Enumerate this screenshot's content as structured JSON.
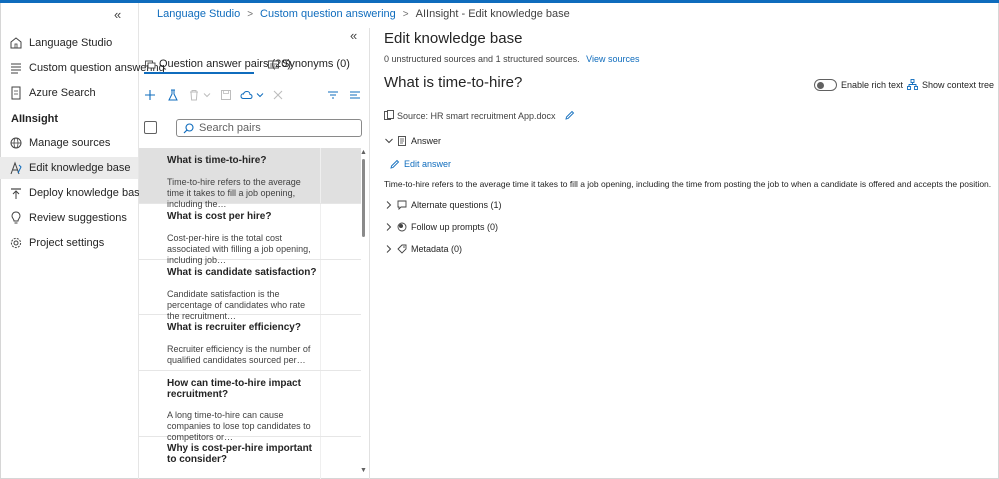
{
  "breadcrumb": {
    "items": [
      "Language Studio",
      "Custom question answering"
    ],
    "current": "AIInsight - Edit knowledge base"
  },
  "nav": {
    "top_items": [
      {
        "label": "Language Studio",
        "icon": "home-icon"
      },
      {
        "label": "Custom question answering",
        "icon": "list-icon"
      },
      {
        "label": "Azure Search",
        "icon": "document-icon"
      }
    ],
    "section": "AIInsight",
    "project_items": [
      {
        "label": "Manage sources",
        "icon": "globe-icon"
      },
      {
        "label": "Edit knowledge base",
        "icon": "edit-kb-icon"
      },
      {
        "label": "Deploy knowledge base",
        "icon": "deploy-icon"
      },
      {
        "label": "Review suggestions",
        "icon": "lightbulb-icon"
      },
      {
        "label": "Project settings",
        "icon": "settings-icon"
      }
    ],
    "active": "Edit knowledge base"
  },
  "middle": {
    "tabs": [
      {
        "label": "Question answer pairs (20)"
      },
      {
        "label": "Synonyms (0)"
      }
    ],
    "search_placeholder": "Search pairs",
    "pairs": [
      {
        "q": "What is time-to-hire?",
        "a": "Time-to-hire refers to the average time it takes to fill a job opening, including the…"
      },
      {
        "q": "What is cost per hire?",
        "a": "Cost-per-hire is the total cost associated with filling a job opening, including job…"
      },
      {
        "q": "What is candidate satisfaction?",
        "a": "Candidate satisfaction is the percentage of candidates who rate the recruitment…"
      },
      {
        "q": "What is recruiter efficiency?",
        "a": "Recruiter efficiency is the number of qualified candidates sourced per…"
      },
      {
        "q": "How can time-to-hire impact recruitment?",
        "a": "A long time-to-hire can cause companies to lose top candidates to competitors or…"
      },
      {
        "q": "Why is cost-per-hire important to consider?",
        "a": ""
      }
    ]
  },
  "main": {
    "title": "Edit knowledge base",
    "sources_text": "0 unstructured sources and 1 structured sources.",
    "view_sources": "View sources",
    "question": "What is time-to-hire?",
    "rich_text_label": "Enable rich text",
    "context_tree_label": "Show context tree",
    "source_text": "Source: HR smart recruitment App.docx",
    "answer_label": "Answer",
    "edit_answer": "Edit answer",
    "answer_text": "Time-to-hire refers to the average time it takes to fill a job opening, including the time from posting the job to when a candidate is offered and accepts the position.",
    "alternate_questions": "Alternate questions (1)",
    "follow_up_prompts": "Follow up prompts (0)",
    "metadata": "Metadata (0)"
  },
  "colors": {
    "accent": "#0f6cbd",
    "selected_row": "#e0e0e0",
    "active_nav": "#ebebeb"
  }
}
